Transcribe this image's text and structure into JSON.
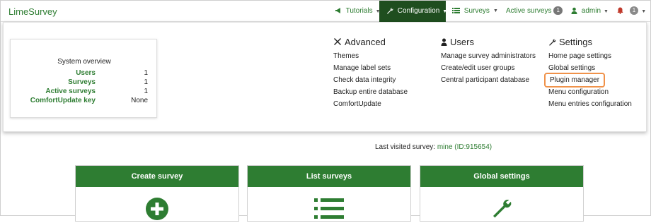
{
  "brand": "LimeSurvey",
  "nav": {
    "tutorials": "Tutorials",
    "configuration": "Configuration",
    "surveys": "Surveys",
    "active_surveys": "Active surveys",
    "active_surveys_count": "1",
    "admin": "admin",
    "notifications_count": "1"
  },
  "overview": {
    "title": "System overview",
    "rows": [
      {
        "label": "Users",
        "value": "1"
      },
      {
        "label": "Surveys",
        "value": "1"
      },
      {
        "label": "Active surveys",
        "value": "1"
      },
      {
        "label": "ComfortUpdate key",
        "value": "None"
      }
    ]
  },
  "menu": {
    "advanced": {
      "title": "Advanced",
      "items": [
        "Themes",
        "Manage label sets",
        "Check data integrity",
        "Backup entire database",
        "ComfortUpdate"
      ]
    },
    "users": {
      "title": "Users",
      "items": [
        "Manage survey administrators",
        "Create/edit user groups",
        "Central participant database"
      ]
    },
    "settings": {
      "title": "Settings",
      "items": [
        "Home page settings",
        "Global settings",
        "Plugin manager",
        "Menu configuration",
        "Menu entries configuration"
      ],
      "highlighted_index": 2
    }
  },
  "last_visited": {
    "prefix": "Last visited survey:",
    "link": "mine (ID:915654)"
  },
  "cards": [
    "Create survey",
    "List surveys",
    "Global settings"
  ],
  "colors": {
    "brand_green": "#2e7d32",
    "nav_active_bg": "#1f4e1f",
    "highlight": "#f0924a"
  }
}
